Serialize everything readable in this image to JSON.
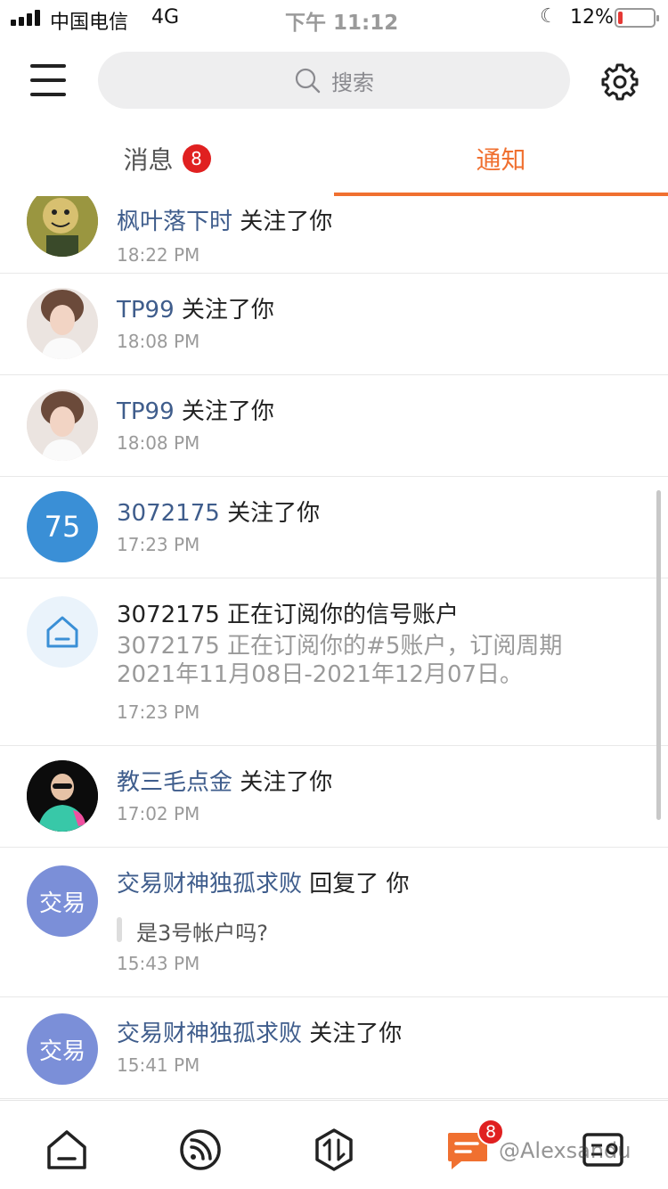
{
  "status": {
    "carrier": "中国电信",
    "network": "4G",
    "time": "下午 11:12",
    "battery_pct": "12%",
    "battery_level": 0.12
  },
  "search": {
    "placeholder": "搜索"
  },
  "tabs": {
    "messages_label": "消息",
    "messages_badge": "8",
    "notifications_label": "通知",
    "active": "通知"
  },
  "notifications": [
    {
      "user": "枫叶落下时",
      "action": "关注了你",
      "time": "18:22 PM"
    },
    {
      "user": "TP99",
      "action": "关注了你",
      "time": "18:08 PM"
    },
    {
      "user": "TP99",
      "action": "关注了你",
      "time": "18:08 PM"
    },
    {
      "user": "3072175",
      "action": "关注了你",
      "time": "17:23 PM",
      "avatar_text": "75"
    },
    {
      "title": "3072175 正在订阅你的信号账户",
      "desc": "3072175 正在订阅你的#5账户，订阅周期2021年11月08日-2021年12月07日。",
      "time": "17:23 PM"
    },
    {
      "user": "教三毛点金",
      "action": "关注了你",
      "time": "17:02 PM"
    },
    {
      "user": "交易财神独孤求败",
      "action": "回复了 你",
      "quote": "是3号帐户吗?",
      "time": "15:43 PM",
      "avatar_text": "交易"
    },
    {
      "user": "交易财神独孤求败",
      "action": "关注了你",
      "time": "15:41 PM",
      "avatar_text": "交易"
    }
  ],
  "bottom_nav": {
    "badge": "8",
    "watermark": "@Alexsandu"
  },
  "colors": {
    "accent": "#f07030",
    "username": "#3f5d8c",
    "badge": "#e02020",
    "avatar_blue": "#3a8fd6",
    "avatar_purple": "#7b8fd8"
  }
}
